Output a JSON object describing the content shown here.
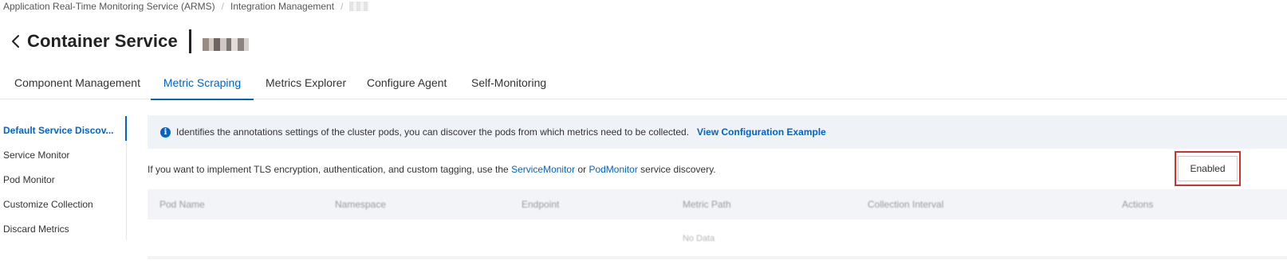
{
  "breadcrumb": {
    "items": [
      "Application Real-Time Monitoring Service (ARMS)",
      "Integration Management"
    ],
    "separator": "/"
  },
  "header": {
    "title": "Container Service",
    "back_icon": "chevron-left-icon"
  },
  "tabs": [
    {
      "label": "Component Management",
      "active": false
    },
    {
      "label": "Metric Scraping",
      "active": true
    },
    {
      "label": "Metrics Explorer",
      "active": false
    },
    {
      "label": "Configure Agent",
      "active": false
    },
    {
      "label": "Self-Monitoring",
      "active": false
    }
  ],
  "side_nav": [
    {
      "label": "Default Service Discov...",
      "active": true
    },
    {
      "label": "Service Monitor",
      "active": false
    },
    {
      "label": "Pod Monitor",
      "active": false
    },
    {
      "label": "Customize Collection",
      "active": false
    },
    {
      "label": "Discard Metrics",
      "active": false
    }
  ],
  "info": {
    "icon": "info-icon",
    "text": "Identifies the annotations settings of the cluster pods, you can discover the pods from which metrics need to be collected.",
    "link": "View Configuration Example"
  },
  "tls": {
    "prefix": "If you want to implement TLS encryption, authentication, and custom tagging, use the",
    "link1": "ServiceMonitor",
    "middle": "or",
    "link2": "PodMonitor",
    "suffix": "service discovery."
  },
  "status_button": {
    "label": "Enabled"
  },
  "table": {
    "columns": [
      "Pod Name",
      "Namespace",
      "Endpoint",
      "Metric Path",
      "Collection Interval",
      "Actions"
    ],
    "empty_text": "No Data"
  },
  "colors": {
    "accent": "#0064c8",
    "highlight": "#d32f2f",
    "info_background": "#eff3f8"
  }
}
